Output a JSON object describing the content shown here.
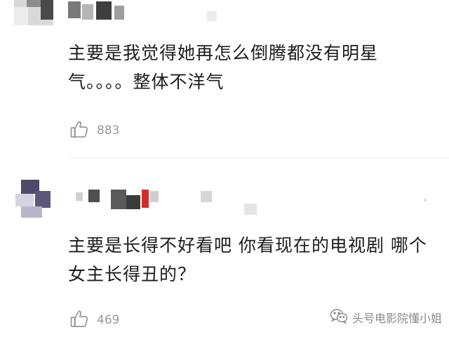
{
  "comments": [
    {
      "text": "主要是我觉得她再怎么倒腾都没有明星气。。。。整体不洋气",
      "like_count": "883"
    },
    {
      "text": "主要是长得不好看吧 你看现在的电视剧 哪个女主长得丑的？",
      "like_count": "469"
    }
  ],
  "watermark": {
    "text": "头号电影院懂小姐",
    "icon": "wechat-icon"
  },
  "icons": {
    "like": "thumbs-up-icon"
  },
  "colors": {
    "text": "#1c1c1c",
    "meta": "#9a9a9a",
    "divider": "#eeeeee",
    "name_accent": "#d42b2b"
  }
}
